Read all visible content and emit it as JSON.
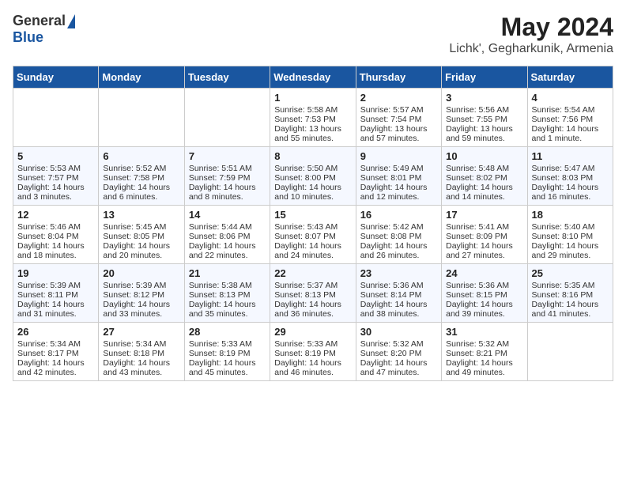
{
  "logo": {
    "general": "General",
    "blue": "Blue"
  },
  "title": "May 2024",
  "location": "Lichk', Gegharkunik, Armenia",
  "days_header": [
    "Sunday",
    "Monday",
    "Tuesday",
    "Wednesday",
    "Thursday",
    "Friday",
    "Saturday"
  ],
  "weeks": [
    [
      {
        "day": "",
        "info": ""
      },
      {
        "day": "",
        "info": ""
      },
      {
        "day": "",
        "info": ""
      },
      {
        "day": "1",
        "info": "Sunrise: 5:58 AM\nSunset: 7:53 PM\nDaylight: 13 hours and 55 minutes."
      },
      {
        "day": "2",
        "info": "Sunrise: 5:57 AM\nSunset: 7:54 PM\nDaylight: 13 hours and 57 minutes."
      },
      {
        "day": "3",
        "info": "Sunrise: 5:56 AM\nSunset: 7:55 PM\nDaylight: 13 hours and 59 minutes."
      },
      {
        "day": "4",
        "info": "Sunrise: 5:54 AM\nSunset: 7:56 PM\nDaylight: 14 hours and 1 minute."
      }
    ],
    [
      {
        "day": "5",
        "info": "Sunrise: 5:53 AM\nSunset: 7:57 PM\nDaylight: 14 hours and 3 minutes."
      },
      {
        "day": "6",
        "info": "Sunrise: 5:52 AM\nSunset: 7:58 PM\nDaylight: 14 hours and 6 minutes."
      },
      {
        "day": "7",
        "info": "Sunrise: 5:51 AM\nSunset: 7:59 PM\nDaylight: 14 hours and 8 minutes."
      },
      {
        "day": "8",
        "info": "Sunrise: 5:50 AM\nSunset: 8:00 PM\nDaylight: 14 hours and 10 minutes."
      },
      {
        "day": "9",
        "info": "Sunrise: 5:49 AM\nSunset: 8:01 PM\nDaylight: 14 hours and 12 minutes."
      },
      {
        "day": "10",
        "info": "Sunrise: 5:48 AM\nSunset: 8:02 PM\nDaylight: 14 hours and 14 minutes."
      },
      {
        "day": "11",
        "info": "Sunrise: 5:47 AM\nSunset: 8:03 PM\nDaylight: 14 hours and 16 minutes."
      }
    ],
    [
      {
        "day": "12",
        "info": "Sunrise: 5:46 AM\nSunset: 8:04 PM\nDaylight: 14 hours and 18 minutes."
      },
      {
        "day": "13",
        "info": "Sunrise: 5:45 AM\nSunset: 8:05 PM\nDaylight: 14 hours and 20 minutes."
      },
      {
        "day": "14",
        "info": "Sunrise: 5:44 AM\nSunset: 8:06 PM\nDaylight: 14 hours and 22 minutes."
      },
      {
        "day": "15",
        "info": "Sunrise: 5:43 AM\nSunset: 8:07 PM\nDaylight: 14 hours and 24 minutes."
      },
      {
        "day": "16",
        "info": "Sunrise: 5:42 AM\nSunset: 8:08 PM\nDaylight: 14 hours and 26 minutes."
      },
      {
        "day": "17",
        "info": "Sunrise: 5:41 AM\nSunset: 8:09 PM\nDaylight: 14 hours and 27 minutes."
      },
      {
        "day": "18",
        "info": "Sunrise: 5:40 AM\nSunset: 8:10 PM\nDaylight: 14 hours and 29 minutes."
      }
    ],
    [
      {
        "day": "19",
        "info": "Sunrise: 5:39 AM\nSunset: 8:11 PM\nDaylight: 14 hours and 31 minutes."
      },
      {
        "day": "20",
        "info": "Sunrise: 5:39 AM\nSunset: 8:12 PM\nDaylight: 14 hours and 33 minutes."
      },
      {
        "day": "21",
        "info": "Sunrise: 5:38 AM\nSunset: 8:13 PM\nDaylight: 14 hours and 35 minutes."
      },
      {
        "day": "22",
        "info": "Sunrise: 5:37 AM\nSunset: 8:13 PM\nDaylight: 14 hours and 36 minutes."
      },
      {
        "day": "23",
        "info": "Sunrise: 5:36 AM\nSunset: 8:14 PM\nDaylight: 14 hours and 38 minutes."
      },
      {
        "day": "24",
        "info": "Sunrise: 5:36 AM\nSunset: 8:15 PM\nDaylight: 14 hours and 39 minutes."
      },
      {
        "day": "25",
        "info": "Sunrise: 5:35 AM\nSunset: 8:16 PM\nDaylight: 14 hours and 41 minutes."
      }
    ],
    [
      {
        "day": "26",
        "info": "Sunrise: 5:34 AM\nSunset: 8:17 PM\nDaylight: 14 hours and 42 minutes."
      },
      {
        "day": "27",
        "info": "Sunrise: 5:34 AM\nSunset: 8:18 PM\nDaylight: 14 hours and 43 minutes."
      },
      {
        "day": "28",
        "info": "Sunrise: 5:33 AM\nSunset: 8:19 PM\nDaylight: 14 hours and 45 minutes."
      },
      {
        "day": "29",
        "info": "Sunrise: 5:33 AM\nSunset: 8:19 PM\nDaylight: 14 hours and 46 minutes."
      },
      {
        "day": "30",
        "info": "Sunrise: 5:32 AM\nSunset: 8:20 PM\nDaylight: 14 hours and 47 minutes."
      },
      {
        "day": "31",
        "info": "Sunrise: 5:32 AM\nSunset: 8:21 PM\nDaylight: 14 hours and 49 minutes."
      },
      {
        "day": "",
        "info": ""
      }
    ]
  ]
}
